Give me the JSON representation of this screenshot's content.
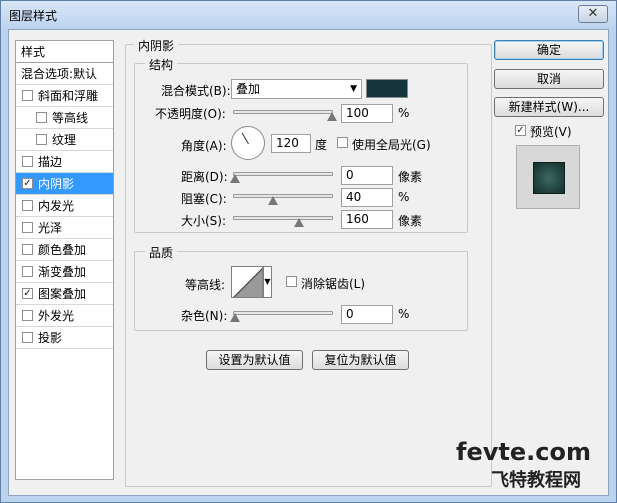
{
  "window": {
    "title": "图层样式",
    "close": "✕"
  },
  "styles": {
    "header": "样式",
    "blend_options": "混合选项:默认",
    "items": [
      {
        "label": "斜面和浮雕",
        "checked": false,
        "indent": false
      },
      {
        "label": "等高线",
        "checked": false,
        "indent": true
      },
      {
        "label": "纹理",
        "checked": false,
        "indent": true
      },
      {
        "label": "描边",
        "checked": false,
        "indent": false
      },
      {
        "label": "内阴影",
        "checked": true,
        "indent": false,
        "selected": true
      },
      {
        "label": "内发光",
        "checked": false,
        "indent": false
      },
      {
        "label": "光泽",
        "checked": false,
        "indent": false
      },
      {
        "label": "颜色叠加",
        "checked": false,
        "indent": false
      },
      {
        "label": "渐变叠加",
        "checked": false,
        "indent": false
      },
      {
        "label": "图案叠加",
        "checked": true,
        "indent": false
      },
      {
        "label": "外发光",
        "checked": false,
        "indent": false
      },
      {
        "label": "投影",
        "checked": false,
        "indent": false
      }
    ]
  },
  "panel": {
    "title": "内阴影",
    "structure": {
      "title": "结构",
      "blend_mode_label": "混合模式(B):",
      "blend_mode_value": "叠加",
      "shadow_color": "#16343c",
      "opacity_label": "不透明度(O):",
      "opacity_value": "100",
      "percent": "%",
      "angle_label": "角度(A):",
      "angle_value": "120",
      "degree": "度",
      "global_light_label": "使用全局光(G)",
      "distance_label": "距离(D):",
      "distance_value": "0",
      "choke_label": "阻塞(C):",
      "choke_value": "40",
      "size_label": "大小(S):",
      "size_value": "160",
      "pixels": "像素"
    },
    "quality": {
      "title": "品质",
      "contour_label": "等高线:",
      "antialias_label": "消除锯齿(L)",
      "noise_label": "杂色(N):",
      "noise_value": "0",
      "percent": "%"
    },
    "set_default": "设置为默认值",
    "reset_default": "复位为默认值"
  },
  "buttons": {
    "ok": "确定",
    "cancel": "取消",
    "new_style": "新建样式(W)...",
    "preview_label": "预览(V)"
  },
  "watermark": {
    "line1": "fevte.com",
    "line2": "飞特教程网"
  }
}
